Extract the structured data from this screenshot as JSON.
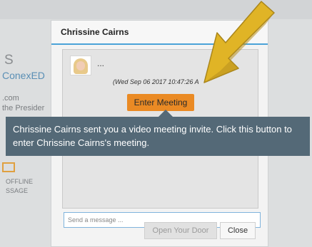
{
  "background": {
    "fragment_s": "S",
    "fragment_conex": "ConexED",
    "fragment_com": ".com",
    "fragment_president": "the Presider",
    "fragment_offline": "OFFLINE",
    "fragment_message": "SSAGE"
  },
  "dialog": {
    "title": "Chrissine Cairns",
    "message": {
      "ellipsis": "...",
      "timestamp": "(Wed Sep 06 2017 10:47:26 A"
    },
    "enter_meeting_label": "Enter Meeting",
    "input_placeholder": "Send a message ...",
    "open_door_label": "Open Your Door",
    "close_label": "Close"
  },
  "tooltip": {
    "text": "Chrissine Cairns sent you a video meeting invite. Click this button to enter Chrissine Cairns's meeting."
  },
  "colors": {
    "accent": "#4aa3d8",
    "button_orange": "#ea8a24",
    "tooltip_bg": "#546977",
    "arrow_gold": "#e0b426"
  },
  "icons": {
    "annotation": "pointer-arrow-icon",
    "mail": "envelope-icon"
  }
}
